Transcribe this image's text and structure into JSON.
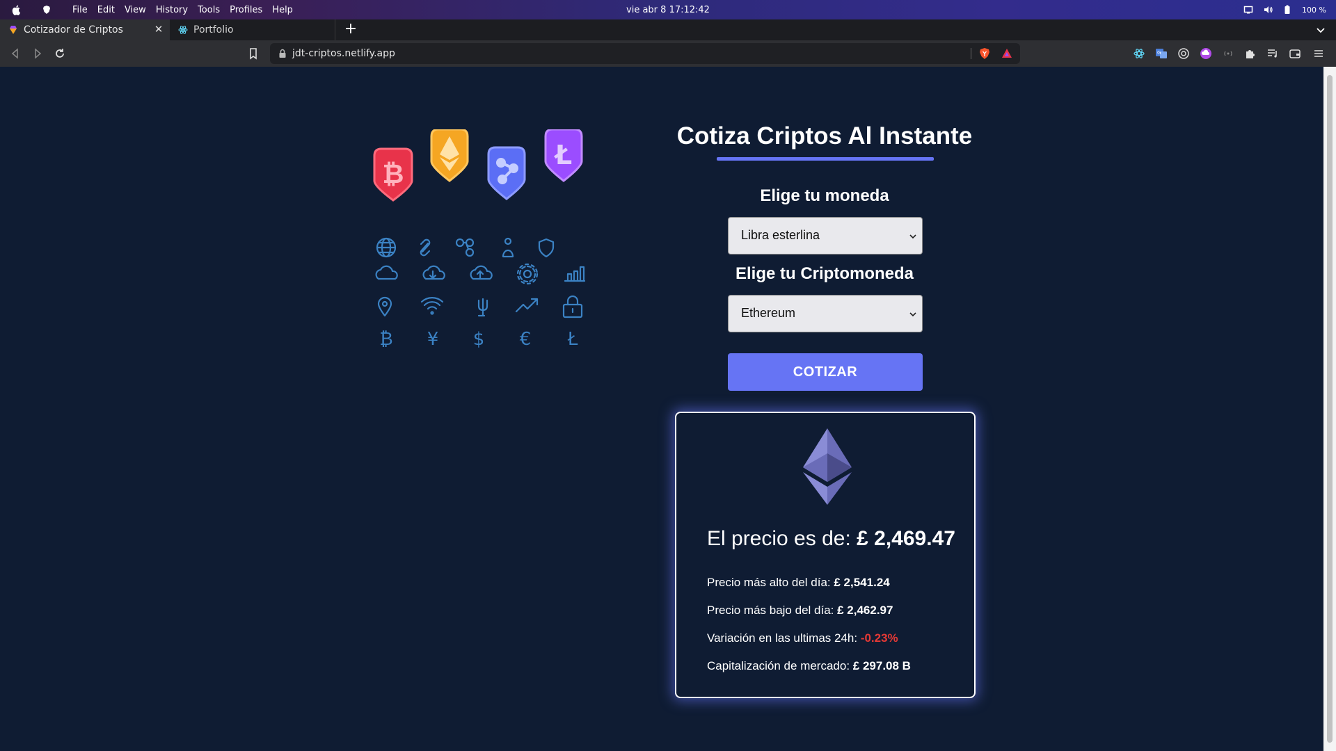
{
  "os": {
    "menu": [
      "File",
      "Edit",
      "View",
      "History",
      "Tools",
      "Profiles",
      "Help"
    ],
    "clock": "vie abr 8  17:12:42",
    "battery": "100 %"
  },
  "tabs": [
    {
      "title": "Cotizador de Criptos",
      "active": true,
      "close": "✕"
    },
    {
      "title": "Portfolio",
      "active": false
    }
  ],
  "newtab": "+",
  "address": {
    "url": "jdt-criptos.netlify.app"
  },
  "page": {
    "title": "Cotiza Criptos Al Instante",
    "currency_label": "Elige tu moneda",
    "currency_value": "Libra esterlina",
    "crypto_label": "Elige tu Criptomoneda",
    "crypto_value": "Ethereum",
    "button": "COTIZAR"
  },
  "result": {
    "price_prefix": "El precio es de: ",
    "price_value": "£ 2,469.47",
    "high_label": "Precio más alto del día: ",
    "high_value": "£ 2,541.24",
    "low_label": "Precio más bajo del día: ",
    "low_value": "£ 2,462.97",
    "change_label": "Variación en las ultimas 24h: ",
    "change_value": "-0.23%",
    "cap_label": "Capitalización de mercado: ",
    "cap_value": "£ 297.08 B"
  },
  "colors": {
    "page_bg": "#0f1c33",
    "accent": "#6674f4",
    "negative": "#e53935",
    "bitcoin_badge": "#e8334a",
    "ether_badge": "#f5a623",
    "ripple_badge": "#5b6ef5",
    "litecoin_badge": "#9b4dff",
    "icon_stroke": "#3b82c4"
  },
  "icons": [
    "globe-icon",
    "link-icon",
    "network-icon",
    "person-icon",
    "shield-icon",
    "cloud-icon",
    "cloud-download-icon",
    "cloud-upload-icon",
    "gear-icon",
    "bar-chart-icon",
    "location-pin-icon",
    "wifi-icon",
    "trident-icon",
    "trend-up-icon",
    "lock-icon",
    "bitcoin-symbol-icon",
    "yen-symbol-icon",
    "dollar-symbol-icon",
    "euro-symbol-icon",
    "litecoin-symbol-icon"
  ]
}
